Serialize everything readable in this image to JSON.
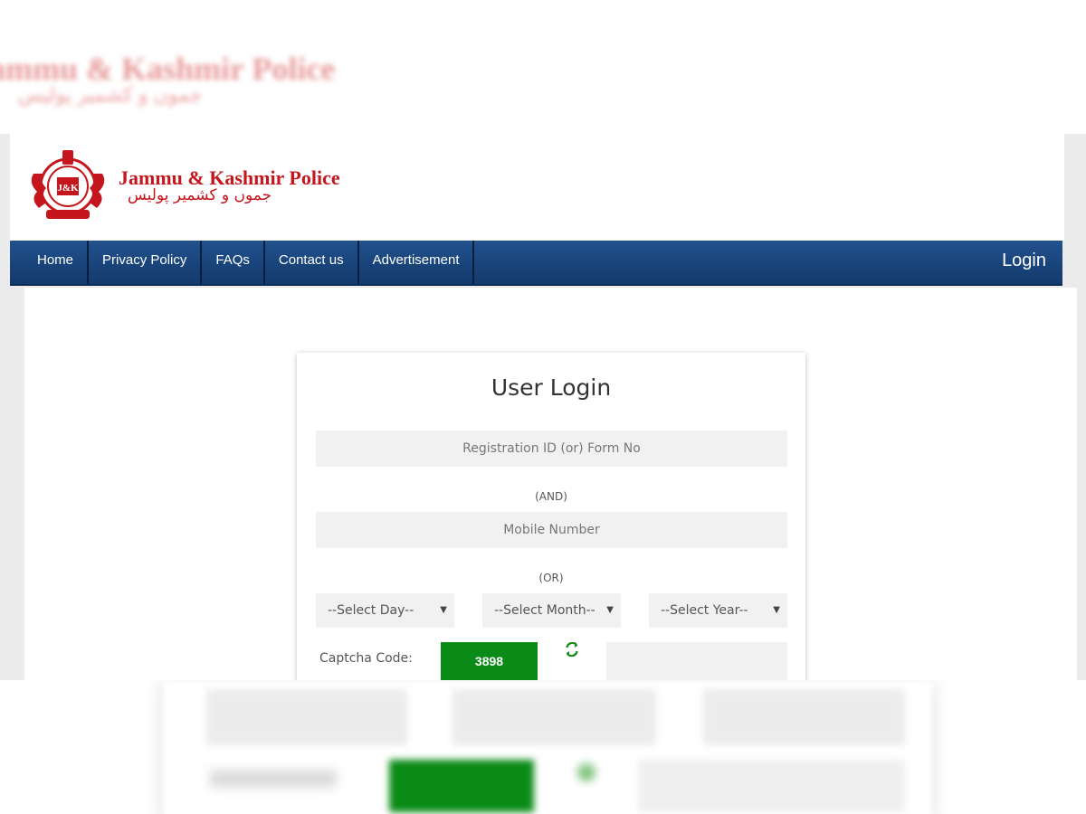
{
  "header": {
    "brand_title": "Jammu & Kashmir Police",
    "brand_subtitle_urdu": "جموں و کشمیر پولیس",
    "logo_icon": "jk-police-emblem-icon"
  },
  "nav": {
    "items": [
      {
        "label": "Home"
      },
      {
        "label": "Privacy Policy"
      },
      {
        "label": "FAQs"
      },
      {
        "label": "Contact us"
      },
      {
        "label": "Advertisement"
      }
    ],
    "login_label": "Login"
  },
  "login_form": {
    "title": "User Login",
    "registration_placeholder": "Registration ID (or) Form No",
    "and_label": "(AND)",
    "mobile_placeholder": "Mobile Number",
    "or_label": "(OR)",
    "day_select": "--Select Day--",
    "month_select": "--Select Month--",
    "year_select": "--Select Year--",
    "captcha_label": "Captcha Code:",
    "captcha_value": "3898",
    "refresh_icon": "refresh-icon"
  },
  "colors": {
    "brand_red": "#c4161c",
    "nav_blue": "#1a4680",
    "captcha_green": "#0a8a16"
  }
}
